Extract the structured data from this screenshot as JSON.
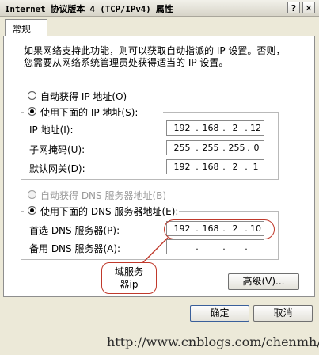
{
  "window": {
    "title": "Internet 协议版本 4 (TCP/IPv4) 属性",
    "help_glyph": "?",
    "close_glyph": "✕"
  },
  "tabs": [
    {
      "label": "常规"
    }
  ],
  "description": "如果网络支持此功能，则可以获取自动指派的 IP 设置。否则，您需要从网络系统管理员处获得适当的 IP 设置。",
  "ip": {
    "auto_label": "自动获得 IP 地址(O)",
    "manual_label": "使用下面的 IP 地址(S):",
    "address_label": "IP 地址(I):",
    "address": [
      "192",
      "168",
      "2",
      "12"
    ],
    "subnet_label": "子网掩码(U):",
    "subnet": [
      "255",
      "255",
      "255",
      "0"
    ],
    "gateway_label": "默认网关(D):",
    "gateway": [
      "192",
      "168",
      "2",
      "1"
    ]
  },
  "dns": {
    "auto_label": "自动获得 DNS 服务器地址(B)",
    "manual_label": "使用下面的 DNS 服务器地址(E):",
    "preferred_label": "首选 DNS 服务器(P):",
    "preferred": [
      "192",
      "168",
      "2",
      "10"
    ],
    "alternate_label": "备用 DNS 服务器(A):",
    "alternate": [
      "",
      "",
      "",
      ""
    ]
  },
  "advanced_label": "高级(V)...",
  "ok_label": "确定",
  "cancel_label": "取消",
  "annotation": {
    "text_line1": "域服务",
    "text_line2": "器ip",
    "color": "#c0392b"
  },
  "watermark": "http://www.cnblogs.com/chenmh/"
}
